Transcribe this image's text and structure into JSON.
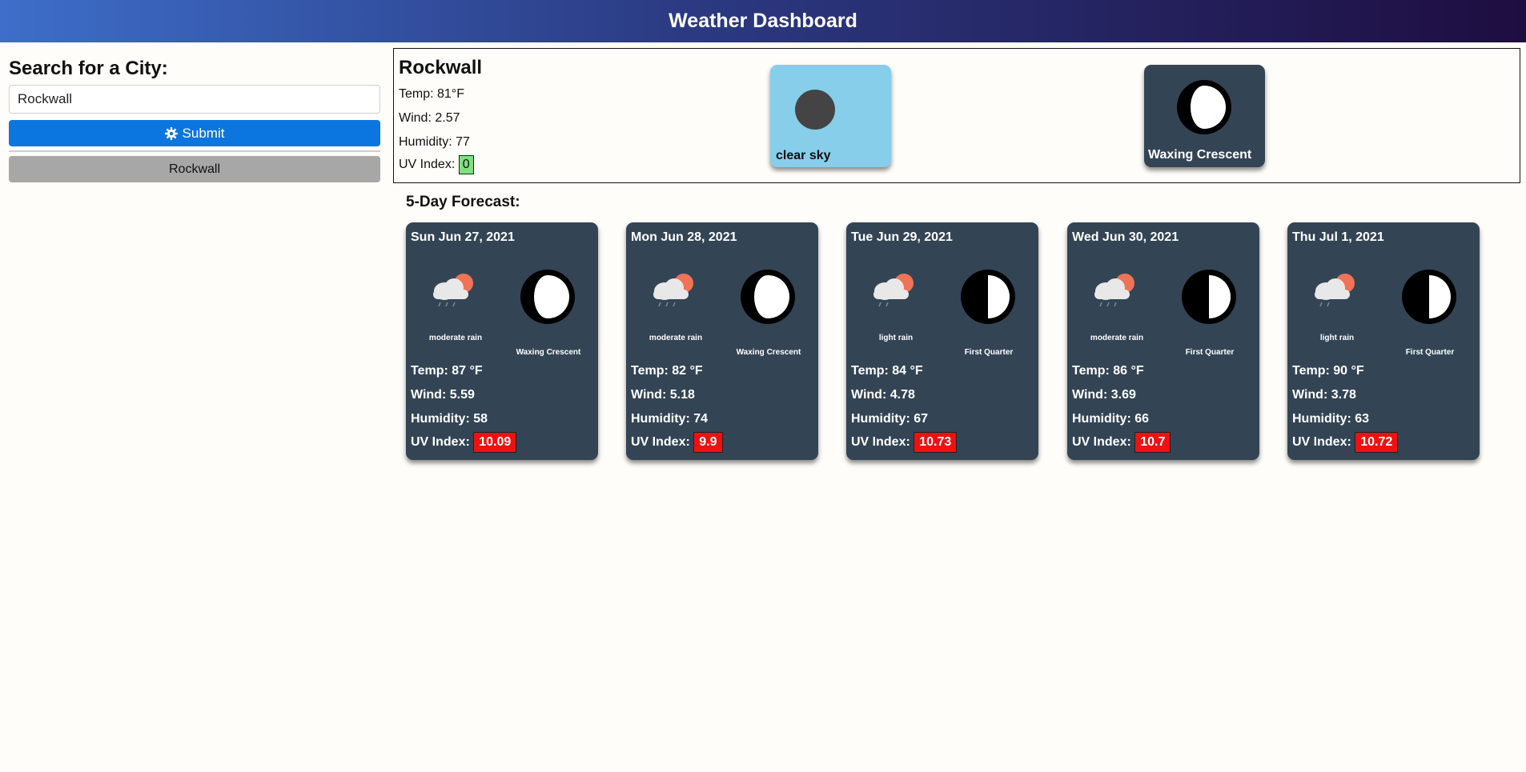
{
  "app": {
    "title": "Weather Dashboard"
  },
  "search": {
    "heading": "Search for a City:",
    "value": "Rockwall",
    "submit_label": "Submit",
    "history": [
      "Rockwall"
    ]
  },
  "current": {
    "city": "Rockwall",
    "temp": "Temp: 81°F",
    "wind": "Wind: 2.57",
    "humidity": "Humidity: 77",
    "uv_label": "UV Index:",
    "uv_value": "0",
    "sky": "clear sky",
    "moon": "Waxing Crescent"
  },
  "forecast": {
    "title": "5-Day Forecast:",
    "days": [
      {
        "date": "Sun Jun 27, 2021",
        "weather": "moderate rain",
        "moon": "Waxing Crescent",
        "temp": "Temp: 87 °F",
        "wind": "Wind: 5.59",
        "humidity": "Humidity: 58",
        "uv_label": "UV Index:",
        "uv": "10.09"
      },
      {
        "date": "Mon Jun 28, 2021",
        "weather": "moderate rain",
        "moon": "Waxing Crescent",
        "temp": "Temp: 82 °F",
        "wind": "Wind: 5.18",
        "humidity": "Humidity: 74",
        "uv_label": "UV Index:",
        "uv": "9.9"
      },
      {
        "date": "Tue Jun 29, 2021",
        "weather": "light rain",
        "moon": "First Quarter",
        "temp": "Temp: 84 °F",
        "wind": "Wind: 4.78",
        "humidity": "Humidity: 67",
        "uv_label": "UV Index:",
        "uv": "10.73"
      },
      {
        "date": "Wed Jun 30, 2021",
        "weather": "moderate rain",
        "moon": "First Quarter",
        "temp": "Temp: 86 °F",
        "wind": "Wind: 3.69",
        "humidity": "Humidity: 66",
        "uv_label": "UV Index:",
        "uv": "10.7"
      },
      {
        "date": "Thu Jul 1, 2021",
        "weather": "light rain",
        "moon": "First Quarter",
        "temp": "Temp: 90 °F",
        "wind": "Wind: 3.78",
        "humidity": "Humidity: 63",
        "uv_label": "UV Index:",
        "uv": "10.72"
      }
    ]
  },
  "colors": {
    "card": "#334455",
    "uv_low": "#7ee07e",
    "uv_high": "#ee1111",
    "submit": "#0b76df",
    "sky": "#87ceeb"
  },
  "icons": {
    "weather": "rain-cloud-sun-icon",
    "moon_waxing_crescent": "waxing-crescent-moon-icon",
    "moon_first_quarter": "first-quarter-moon-icon",
    "submit": "gear-icon"
  }
}
